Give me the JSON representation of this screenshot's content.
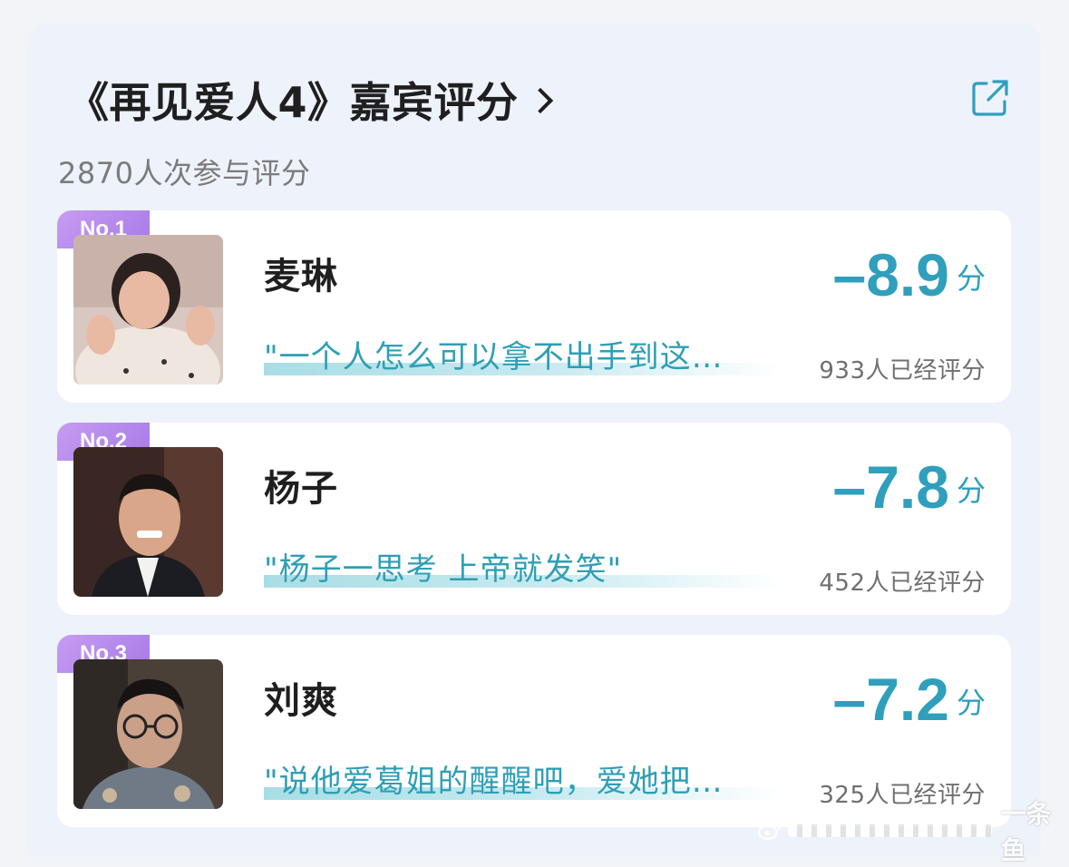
{
  "header": {
    "title": "《再见爱人4》嘉宾评分",
    "participants": "2870人次参与评分",
    "share_icon": "share-icon"
  },
  "guests": [
    {
      "rank": "No.1",
      "name": "麦琳",
      "quote": "\"一个人怎么可以拿不出手到这…",
      "score": "–8.9",
      "unit": "分",
      "count": "933人已经评分"
    },
    {
      "rank": "No.2",
      "name": "杨子",
      "quote": "\"杨子一思考 上帝就发笑\"",
      "score": "–7.8",
      "unit": "分",
      "count": "452人已经评分"
    },
    {
      "rank": "No.3",
      "name": "刘爽",
      "quote": "\"说他爱葛姐的醒醒吧，爱她把…",
      "score": "–7.2",
      "unit": "分",
      "count": "325人已经评分"
    }
  ],
  "watermark": {
    "text": "一条鱼"
  },
  "colors": {
    "accent": "#2f9fbc",
    "rank_badge": "#b48af0",
    "underline": "#a9dde5"
  }
}
